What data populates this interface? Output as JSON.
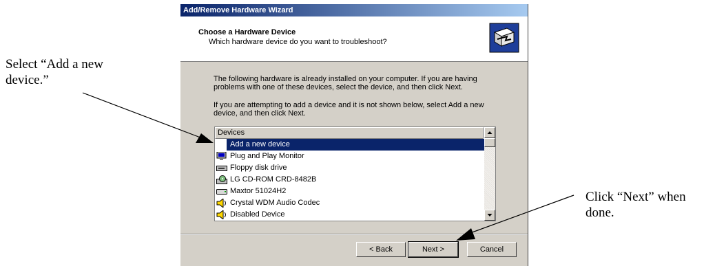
{
  "callouts": {
    "left": "Select “Add a new device.”",
    "right": "Click “Next” when done."
  },
  "wizard": {
    "title": "Add/Remove Hardware Wizard",
    "header_title": "Choose a Hardware Device",
    "header_subtitle": "Which hardware device do you want to troubleshoot?",
    "intro_text": "The following hardware is already installed on your computer. If you are having problems with one of these devices, select the device, and then click Next.",
    "add_text": "If you are attempting to add a device and it is not shown below, select Add a new device, and then click Next.",
    "list_header": "Devices",
    "devices": [
      {
        "label": "Add a new device",
        "icon": "none",
        "selected": true
      },
      {
        "label": "Plug and Play Monitor",
        "icon": "monitor-icon"
      },
      {
        "label": "Floppy disk drive",
        "icon": "floppy-drive-icon"
      },
      {
        "label": "LG CD-ROM CRD-8482B",
        "icon": "cd-rom-icon"
      },
      {
        "label": "Maxtor 51024H2",
        "icon": "hard-disk-icon"
      },
      {
        "label": "Crystal WDM Audio Codec",
        "icon": "audio-icon"
      },
      {
        "label": "Disabled Device",
        "icon": "audio-icon"
      }
    ],
    "buttons": {
      "back": "< Back",
      "next": "Next >",
      "cancel": "Cancel"
    }
  }
}
